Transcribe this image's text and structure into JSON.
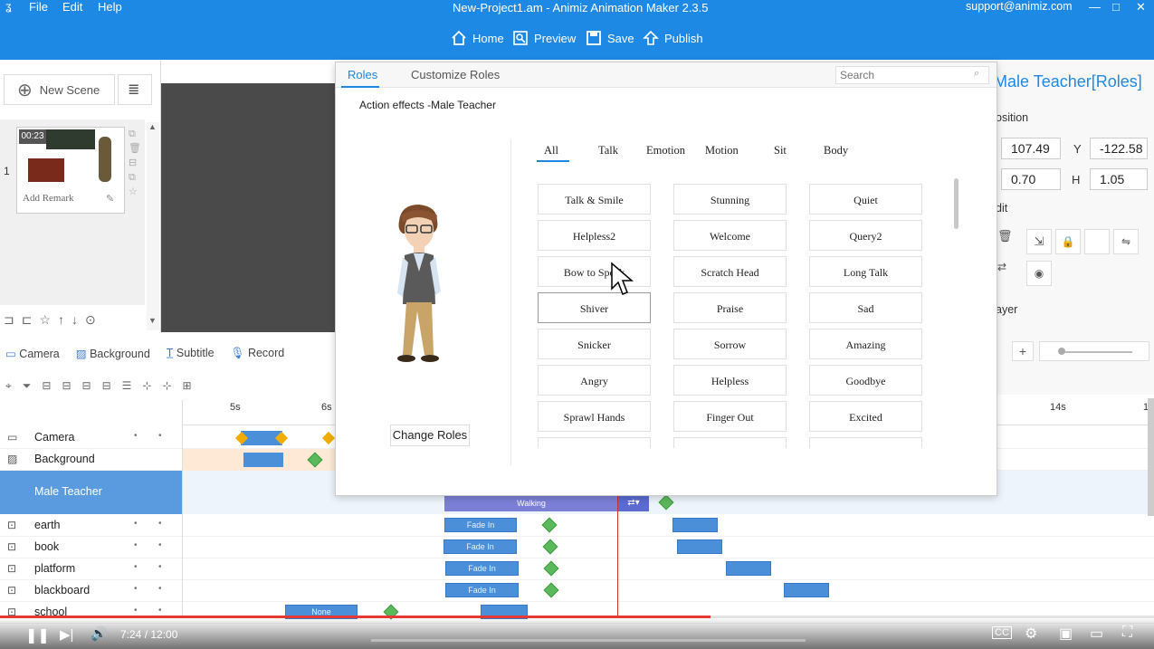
{
  "title_bar": {
    "menus": [
      "File",
      "Edit",
      "Help"
    ],
    "title": "New-Project1.am - Animiz Animation Maker 2.3.5",
    "email": "support@animiz.com",
    "toolbar": {
      "home": "Home",
      "preview": "Preview",
      "save": "Save",
      "publish": "Publish"
    },
    "window_controls": [
      "—",
      "□",
      "✕"
    ]
  },
  "scenes": {
    "new_scene_label": "New Scene",
    "scene_number": "1",
    "scene_time": "00:23",
    "add_remark": "Add Remark"
  },
  "track_toolbar": {
    "camera": "Camera",
    "background": "Background",
    "subtitle": "Subtitle",
    "record": "Record"
  },
  "ruler_ticks": [
    "5s",
    "6s",
    "14s",
    "1"
  ],
  "tracks": [
    {
      "name": "Camera"
    },
    {
      "name": "Background"
    },
    {
      "name": "Male Teacher"
    },
    {
      "name": "earth",
      "clip": "Fade In"
    },
    {
      "name": "book",
      "clip": "Fade In"
    },
    {
      "name": "platform",
      "clip": "Fade In"
    },
    {
      "name": "blackboard",
      "clip": "Fade In"
    },
    {
      "name": "school",
      "clip": "None"
    }
  ],
  "walking_clip": "Walking",
  "right_panel": {
    "title": "Male Teacher[Roles]",
    "position_label": "osition",
    "x_value": "107.49",
    "y_label": "Y",
    "y_value": "-122.58",
    "w_value": "0.70",
    "h_label": "H",
    "h_value": "1.05",
    "edit_label": "dit",
    "layer_label": "ayer"
  },
  "dialog": {
    "tabs": [
      "Roles",
      "Customize Roles"
    ],
    "search_placeholder": "Search",
    "subtitle": "Action effects -Male Teacher",
    "categories": [
      "All",
      "Talk",
      "Emotion",
      "Motion",
      "Sit",
      "Body"
    ],
    "change_roles": "Change Roles",
    "actions": [
      [
        "Talk & Smile",
        "Stunning",
        "Quiet"
      ],
      [
        "Helpless2",
        "Welcome",
        "Query2"
      ],
      [
        "Bow to Speak",
        "Scratch Head",
        "Long Talk"
      ],
      [
        "Shiver",
        "Praise",
        "Sad"
      ],
      [
        "Snicker",
        "Sorrow",
        "Amazing"
      ],
      [
        "Angry",
        "Helpless",
        "Goodbye"
      ],
      [
        "Sprawl Hands",
        "Finger Out",
        "Excited"
      ]
    ]
  },
  "player": {
    "time": "7:24 / 12:00"
  },
  "colors": {
    "brand": "#1e88e5",
    "accent_red": "#e53935",
    "selected_track": "#5a9be0"
  }
}
